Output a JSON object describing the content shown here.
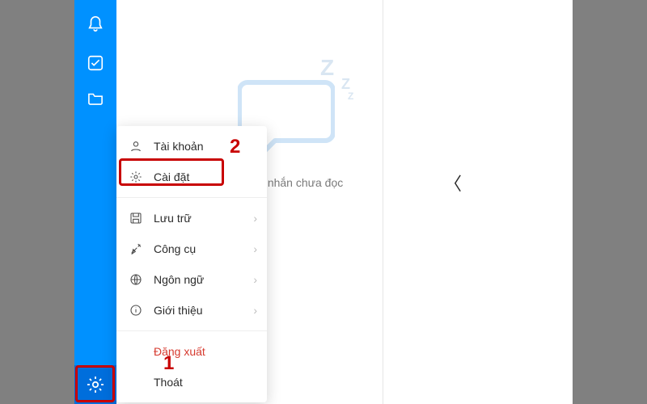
{
  "empty_state": {
    "text": "ng có tin nhắn chưa đọc"
  },
  "menu": {
    "account": {
      "label": "Tài khoản"
    },
    "settings": {
      "label": "Cài đặt"
    },
    "storage": {
      "label": "Lưu trữ"
    },
    "tools": {
      "label": "Công cụ"
    },
    "language": {
      "label": "Ngôn ngữ"
    },
    "about": {
      "label": "Giới thiệu"
    },
    "logout": {
      "label": "Đăng xuất"
    },
    "quit": {
      "label": "Thoát"
    }
  },
  "annotations": {
    "one": "1",
    "two": "2"
  }
}
